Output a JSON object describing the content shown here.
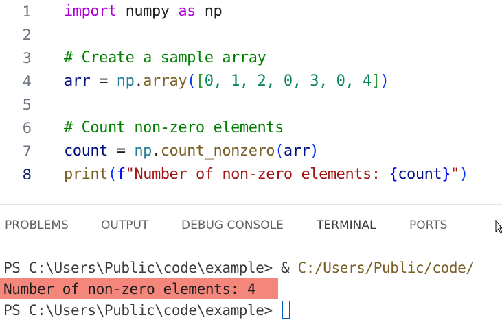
{
  "editor": {
    "lines": [
      {
        "number": "1",
        "tokens": {
          "kw1": "import",
          "mod": "numpy",
          "kw2": "as",
          "alias": "np"
        }
      },
      {
        "number": "2"
      },
      {
        "number": "3",
        "comment": "# Create a sample array"
      },
      {
        "number": "4",
        "tokens": {
          "var": "arr",
          "eq": " = ",
          "obj": "np",
          "dot": ".",
          "fn": "array",
          "open_paren": "(",
          "open_bracket": "[",
          "values": "0, 1, 2, 0, 3, 0, 4",
          "close_bracket": "]",
          "close_paren": ")"
        }
      },
      {
        "number": "5"
      },
      {
        "number": "6",
        "comment": "# Count non-zero elements"
      },
      {
        "number": "7",
        "tokens": {
          "var": "count",
          "eq": " = ",
          "obj": "np",
          "dot": ".",
          "fn": "count_nonzero",
          "open_paren": "(",
          "arg": "arr",
          "close_paren": ")"
        }
      },
      {
        "number": "8",
        "tokens": {
          "fn": "print",
          "open_paren": "(",
          "prefix": "f",
          "str_start": "\"Number of non-zero elements: ",
          "brace_open": "{",
          "var": "count",
          "brace_close": "}",
          "str_end": "\"",
          "close_paren": ")"
        }
      }
    ],
    "active_line": "8"
  },
  "panel": {
    "tabs": [
      "PROBLEMS",
      "OUTPUT",
      "DEBUG CONSOLE",
      "TERMINAL",
      "PORTS"
    ],
    "active_tab": "TERMINAL",
    "terminal": {
      "line1_prompt": "PS C:\\Users\\Public\\code\\example> ",
      "line1_op": "& ",
      "line1_path": "C:/Users/Public/code/",
      "output": "Number of non-zero elements: 4",
      "line3_prompt": "PS C:\\Users\\Public\\code\\example> "
    }
  },
  "colors": {
    "output_highlight": "#f4867c",
    "active_tab_underline": "#005fb8"
  }
}
